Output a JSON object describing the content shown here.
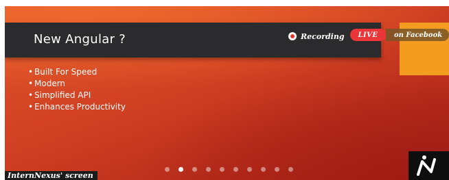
{
  "slide": {
    "title": "New Angular ?",
    "bullets": [
      "Built For Speed",
      "Modern",
      "Simplified API",
      "Enhances Productivity"
    ],
    "pagination": {
      "total": 10,
      "active_index": 1
    }
  },
  "broadcast": {
    "recording_label": "Recording",
    "live_label": "LIVE",
    "platform_label": "on Facebook"
  },
  "caption": "InternNexus' screen",
  "colors": {
    "slide_orange": "#e2552a",
    "slide_red": "#9e1f16",
    "title_band": "#2b2b2d",
    "accent_orange": "#f39c1f",
    "live_red": "#ea3539"
  },
  "icons": {
    "recording": "record-dot-icon",
    "logo": "nexus-logo"
  }
}
